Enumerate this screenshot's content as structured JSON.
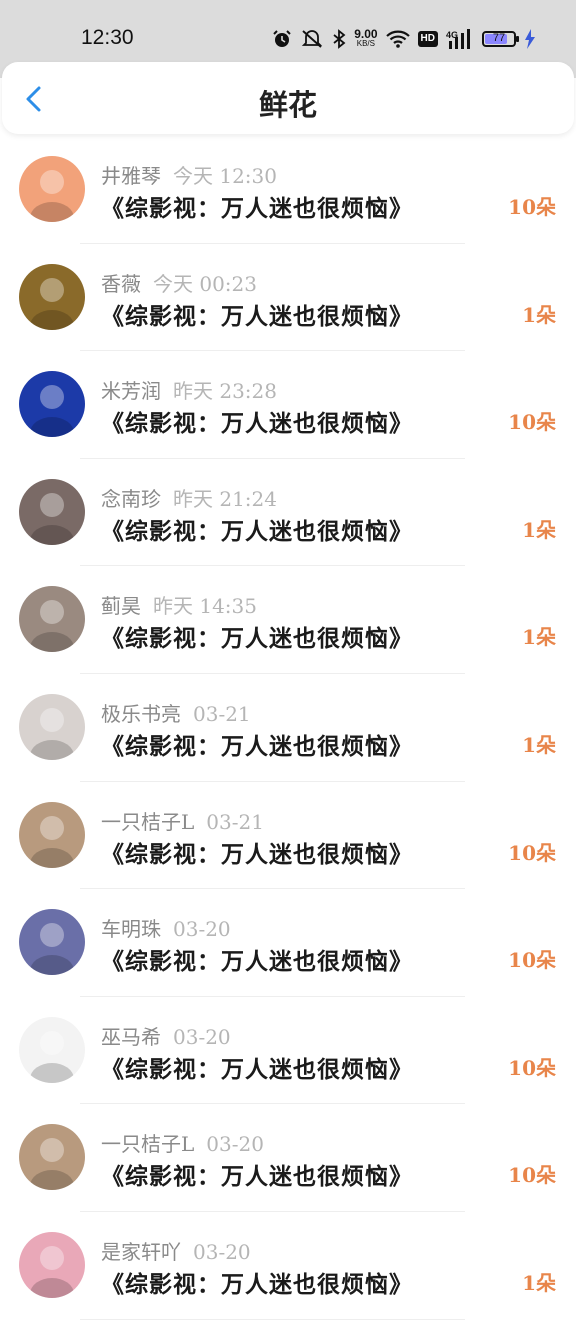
{
  "status_bar": {
    "time": "12:30",
    "net_speed_value": "9.00",
    "net_speed_unit": "KB/S",
    "hd_badge": "HD",
    "signal_label": "4G",
    "battery": "77",
    "battery_level": 0.77,
    "battery_color": "#8b86ff",
    "icons": [
      "alarm-icon",
      "mute-icon",
      "bluetooth-icon",
      "wifi-icon",
      "signal-icon",
      "charging-icon"
    ]
  },
  "header": {
    "title": "鲜花",
    "back_icon": "chevron-left-icon",
    "accent": "#2d8ee8"
  },
  "count_color": "#e8854a",
  "items": [
    {
      "name": "井雅琴",
      "time": "今天 12:30",
      "book": "《综影视：万人迷也很烦恼》",
      "count": "10朵",
      "avatar_color": "#f2a27a"
    },
    {
      "name": "香薇",
      "time": "今天 00:23",
      "book": "《综影视：万人迷也很烦恼》",
      "count": "1朵",
      "avatar_color": "#8a6a2a"
    },
    {
      "name": "米芳润",
      "time": "昨天 23:28",
      "book": "《综影视：万人迷也很烦恼》",
      "count": "10朵",
      "avatar_color": "#1c3aa8"
    },
    {
      "name": "念南珍",
      "time": "昨天 21:24",
      "book": "《综影视：万人迷也很烦恼》",
      "count": "1朵",
      "avatar_color": "#7a6a66"
    },
    {
      "name": "蓟昊",
      "time": "昨天 14:35",
      "book": "《综影视：万人迷也很烦恼》",
      "count": "1朵",
      "avatar_color": "#9a8a80"
    },
    {
      "name": "极乐书亮",
      "time": "03-21",
      "book": "《综影视：万人迷也很烦恼》",
      "count": "1朵",
      "avatar_color": "#d8d2cf"
    },
    {
      "name": "一只桔子L",
      "time": "03-21",
      "book": "《综影视：万人迷也很烦恼》",
      "count": "10朵",
      "avatar_color": "#b89a7e"
    },
    {
      "name": "车明珠",
      "time": "03-20",
      "book": "《综影视：万人迷也很烦恼》",
      "count": "10朵",
      "avatar_color": "#6a6fa8"
    },
    {
      "name": "巫马希",
      "time": "03-20",
      "book": "《综影视：万人迷也很烦恼》",
      "count": "10朵",
      "avatar_color": "#f3f3f3"
    },
    {
      "name": "一只桔子L",
      "time": "03-20",
      "book": "《综影视：万人迷也很烦恼》",
      "count": "10朵",
      "avatar_color": "#b89a7e"
    },
    {
      "name": "是家轩吖",
      "time": "03-20",
      "book": "《综影视：万人迷也很烦恼》",
      "count": "1朵",
      "avatar_color": "#e9a8b8"
    }
  ]
}
